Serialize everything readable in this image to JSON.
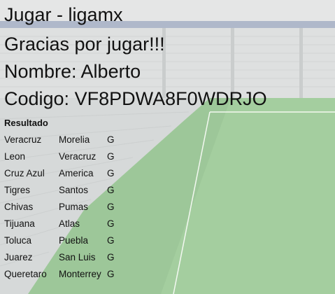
{
  "header": {
    "title": "Jugar - ligamx",
    "thanks": "Gracias por jugar!!!",
    "name_line": "Nombre: Alberto",
    "code_line": "Codigo: VF8PDWA8F0WDRJO"
  },
  "results": {
    "label": "Resultado",
    "rows": [
      {
        "home": "Veracruz",
        "away": "Morelia",
        "pick": "G"
      },
      {
        "home": "Leon",
        "away": "Veracruz",
        "pick": "G"
      },
      {
        "home": "Cruz Azul",
        "away": "America",
        "pick": "G"
      },
      {
        "home": "Tigres",
        "away": "Santos",
        "pick": "G"
      },
      {
        "home": "Chivas",
        "away": "Pumas",
        "pick": "G"
      },
      {
        "home": "Tijuana",
        "away": "Atlas",
        "pick": "G"
      },
      {
        "home": "Toluca",
        "away": "Puebla",
        "pick": "G"
      },
      {
        "home": "Juarez",
        "away": "San Luis",
        "pick": "G"
      },
      {
        "home": "Queretaro",
        "away": "Monterrey",
        "pick": "G"
      }
    ]
  },
  "colors": {
    "pitch": "#3f8f3a",
    "pitch_light": "#55a24c",
    "stands": "#b9bdbd",
    "roof_band": "#5a6c8f"
  }
}
